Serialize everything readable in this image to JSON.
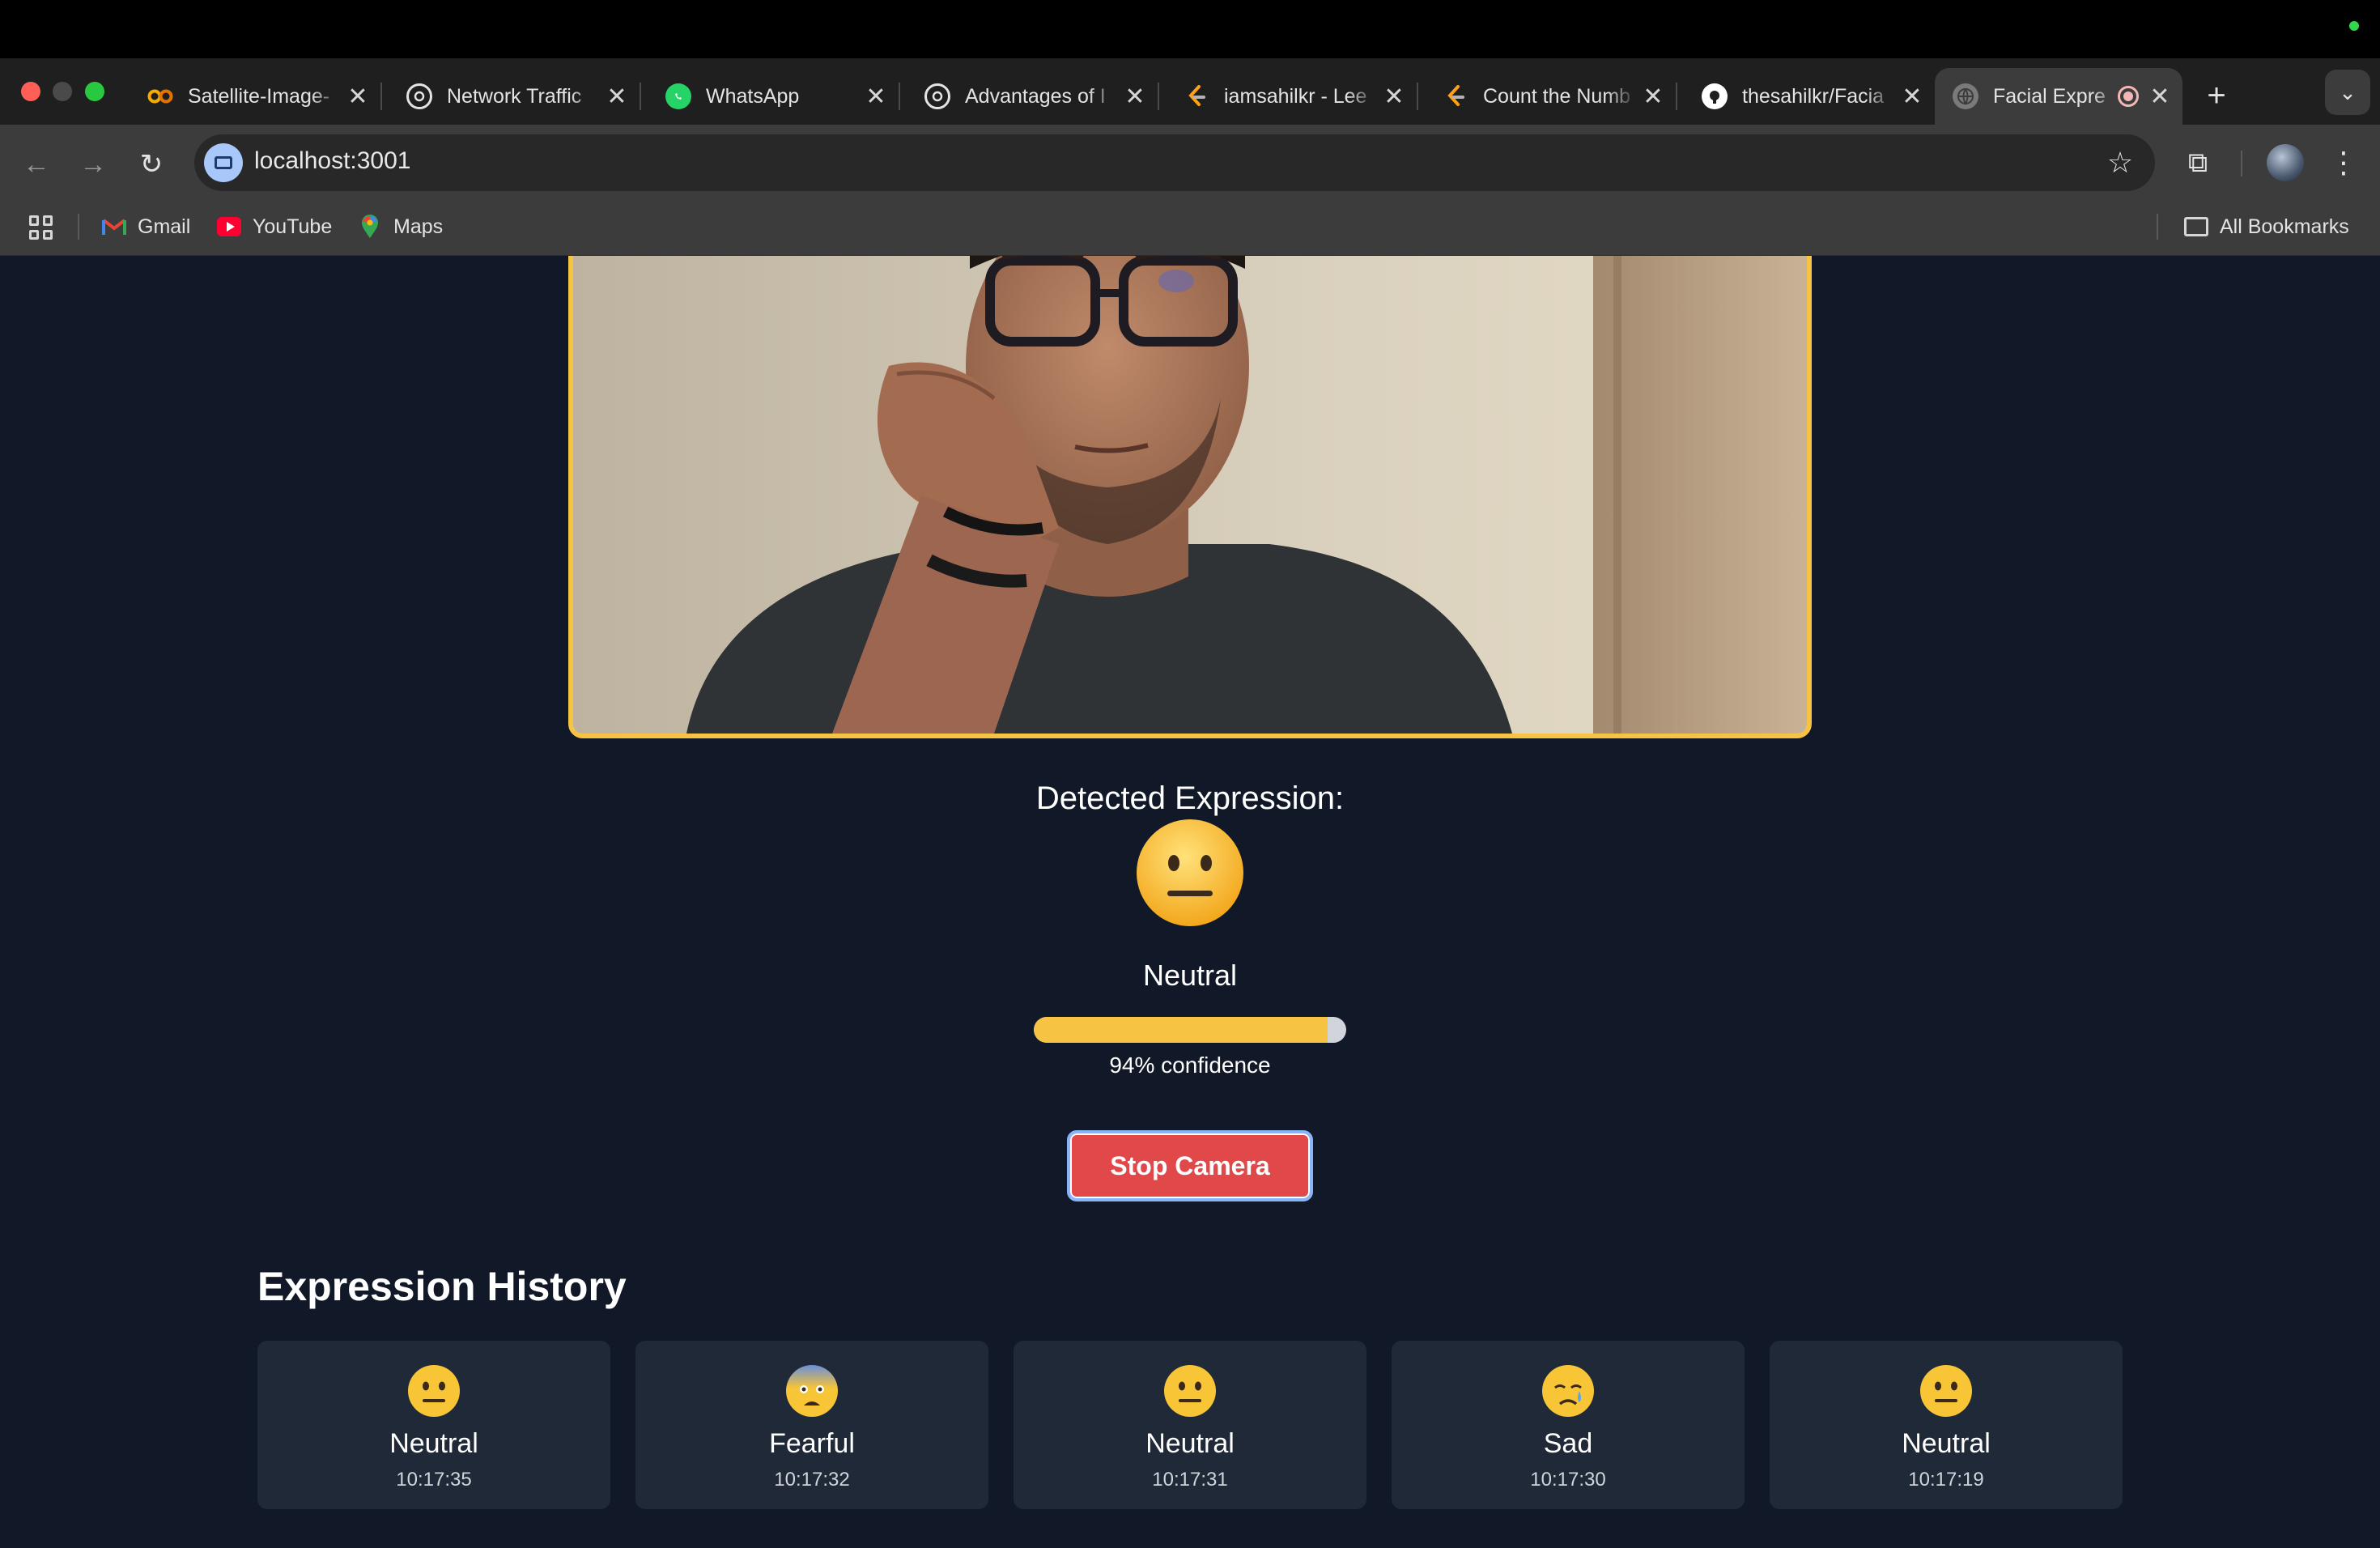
{
  "browser": {
    "tabs": [
      {
        "title": "Satellite-Image-",
        "icon": "colab-icon",
        "active": false
      },
      {
        "title": "Network Traffic",
        "icon": "openai-icon",
        "active": false
      },
      {
        "title": "WhatsApp",
        "icon": "whatsapp-icon",
        "active": false
      },
      {
        "title": "Advantages of I",
        "icon": "openai-icon",
        "active": false
      },
      {
        "title": "iamsahilkr - Lee",
        "icon": "leetcode-icon",
        "active": false
      },
      {
        "title": "Count the Numb",
        "icon": "leetcode-icon",
        "active": false
      },
      {
        "title": "thesahilkr/Facia",
        "icon": "github-icon",
        "active": false
      },
      {
        "title": "Facial Expre",
        "icon": "globe-icon",
        "active": true
      }
    ],
    "url": "localhost:3001",
    "bookmarks": [
      {
        "label": "Gmail",
        "icon": "gmail-icon"
      },
      {
        "label": "YouTube",
        "icon": "youtube-icon"
      },
      {
        "label": "Maps",
        "icon": "maps-icon"
      }
    ],
    "all_bookmarks_label": "All Bookmarks"
  },
  "detector": {
    "heading": "Detected Expression:",
    "expression": "Neutral",
    "confidence": 0.94,
    "confidence_text": "94% confidence",
    "button_label": "Stop Camera"
  },
  "history": {
    "title": "Expression History",
    "items": [
      {
        "label": "Neutral",
        "time": "10:17:35",
        "emoji": "neutral-face"
      },
      {
        "label": "Fearful",
        "time": "10:17:32",
        "emoji": "fearful-face"
      },
      {
        "label": "Neutral",
        "time": "10:17:31",
        "emoji": "neutral-face"
      },
      {
        "label": "Sad",
        "time": "10:17:30",
        "emoji": "crying-face"
      },
      {
        "label": "Neutral",
        "time": "10:17:19",
        "emoji": "neutral-face"
      }
    ]
  },
  "colors": {
    "accent": "#f6c343",
    "page_bg": "#111827",
    "card_bg": "#1f2937",
    "stop_button": "#e0484a"
  }
}
